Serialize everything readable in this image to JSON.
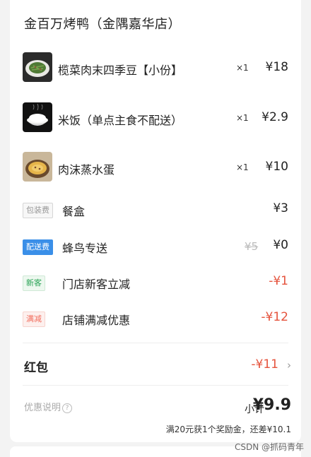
{
  "shop": {
    "title": "金百万烤鸭（金隅嘉华店）"
  },
  "items": [
    {
      "name": "榄菜肉末四季豆【小份】",
      "qty": "×1",
      "price": "¥18",
      "image": "green-beans-dish"
    },
    {
      "name": "米饭（单点主食不配送）",
      "qty": "×1",
      "price": "¥2.9",
      "image": "rice-bowl"
    },
    {
      "name": "肉沫蒸水蛋",
      "qty": "×1",
      "price": "¥10",
      "image": "steamed-egg"
    }
  ],
  "fees": {
    "packaging": {
      "tag": "包装费",
      "label": "餐盒",
      "value": "¥3"
    },
    "delivery": {
      "tag": "配送费",
      "label": "蜂鸟专送",
      "original": "¥5",
      "value": "¥0"
    },
    "new_customer": {
      "tag": "新客",
      "label": "门店新客立减",
      "value": "-¥1"
    },
    "full_reduction": {
      "tag": "满减",
      "label": "店铺满减优惠",
      "value": "-¥12"
    }
  },
  "hongbao": {
    "label": "红包",
    "value": "-¥11"
  },
  "summary": {
    "promo_info": "优惠说明",
    "subtotal_label": "小计",
    "subtotal_value": "¥9.9",
    "reward_note": "满20元获1个奖励金，还差¥10.1"
  },
  "watermark": "CSDN @抓码青年",
  "colors": {
    "accent_red": "#e5533d",
    "delivery_blue": "#3a8fe8",
    "new_green": "#2aa356"
  }
}
